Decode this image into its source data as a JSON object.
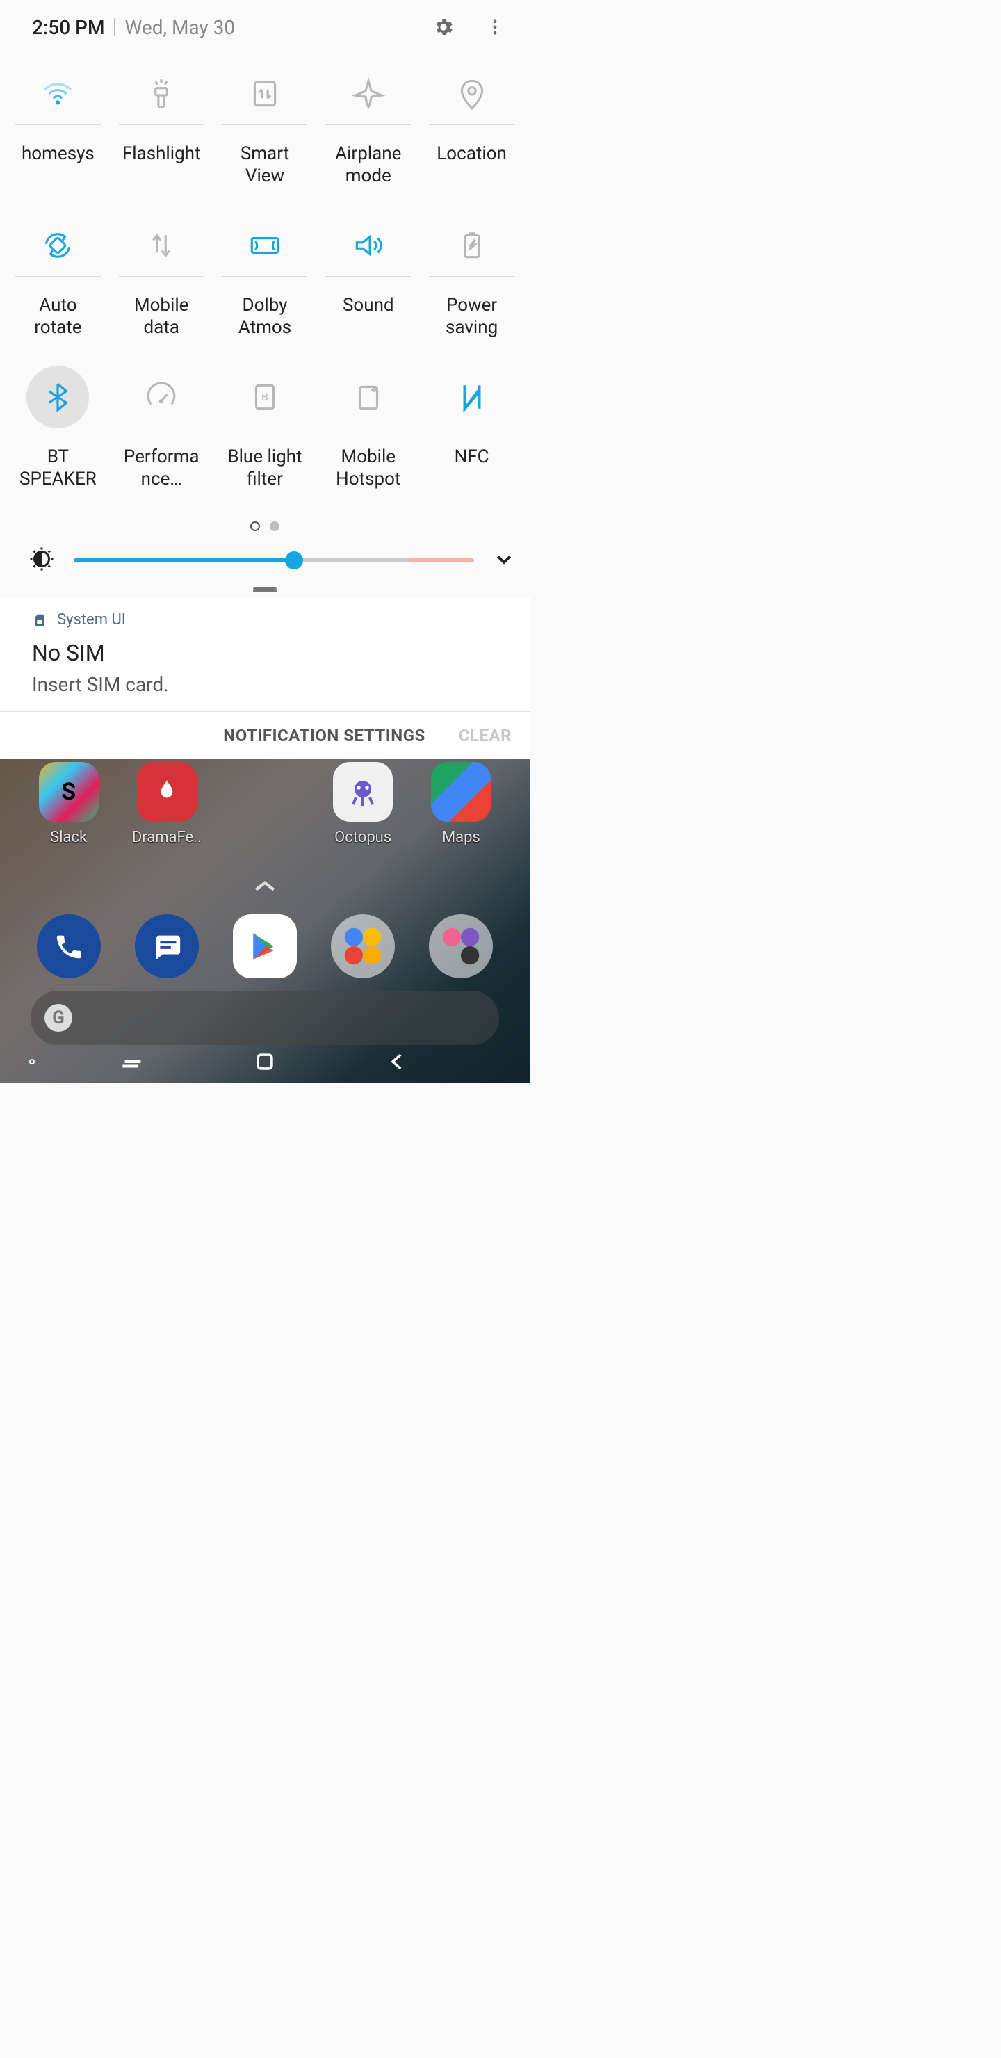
{
  "header": {
    "time": "2:50 PM",
    "date": "Wed, May 30"
  },
  "tiles": [
    {
      "id": "wifi",
      "label": "homesys",
      "active": true
    },
    {
      "id": "flashlight",
      "label": "Flashlight",
      "active": false
    },
    {
      "id": "smartview",
      "label": "Smart View",
      "active": false
    },
    {
      "id": "airplane",
      "label": "Airplane mode",
      "active": false
    },
    {
      "id": "location",
      "label": "Location",
      "active": false
    },
    {
      "id": "autorotate",
      "label": "Auto rotate",
      "active": true
    },
    {
      "id": "mobiledata",
      "label": "Mobile data",
      "active": false
    },
    {
      "id": "dolby",
      "label": "Dolby Atmos",
      "active": true
    },
    {
      "id": "sound",
      "label": "Sound",
      "active": true
    },
    {
      "id": "powersave",
      "label": "Power saving",
      "active": false
    },
    {
      "id": "bluetooth",
      "label": "BT SPEAKER",
      "active": true
    },
    {
      "id": "perf",
      "label": "Performance…",
      "active": false
    },
    {
      "id": "bluelight",
      "label": "Blue light filter",
      "active": false
    },
    {
      "id": "hotspot",
      "label": "Mobile Hotspot",
      "active": false
    },
    {
      "id": "nfc",
      "label": "NFC",
      "active": true
    }
  ],
  "brightness": {
    "percent": 55
  },
  "notification": {
    "app": "System UI",
    "title": "No SIM",
    "body": "Insert SIM card."
  },
  "footer": {
    "settings": "NOTIFICATION SETTINGS",
    "clear": "CLEAR"
  },
  "home_apps_top": [
    {
      "label": "Slack"
    },
    {
      "label": "DramaFe.."
    },
    {
      "label": ""
    },
    {
      "label": "Octopus"
    },
    {
      "label": "Maps"
    }
  ],
  "icons": {
    "wifi": "<svg viewBox='0 0 48 48' stroke-width='3'><path d='M6 18c10-10 26-10 36 0' opacity='.35'/><path d='M12 24c7-7 17-7 24 0' opacity='.55'/><path d='M18 30c4-4 8-4 12 0' opacity='.8'/><circle cx='24' cy='36' r='3' class='fillblue'/></svg>",
    "flashlight": "<svg viewBox='0 0 48 48' stroke-width='3'><path d='M24 4v5M16 7l3 4M32 7l-3 4'/><rect x='16' y='16' width='16' height='10' rx='2'/><path d='M20 26v14a2 2 0 0 0 2 2h4a2 2 0 0 0 2-2V26'/></svg>",
    "smartview": "<svg viewBox='0 0 48 48' stroke-width='3'><rect x='10' y='8' width='28' height='32' rx='3'/><path d='M20 18v12M28 30V18'/><path d='M16 22l4-4M32 26l-4 4'/></svg>",
    "airplane": "<svg viewBox='0 0 48 48' stroke-width='3'><path d='M24 6l4 14 14 6-14 2-2 10-2 4-2-4-2-10-14-2 14-6z'/></svg>",
    "location": "<svg viewBox='0 0 48 48' stroke-width='3'><path d='M24 44s14-14 14-24a14 14 0 1 0-28 0c0 10 14 24 14 24z'/><circle cx='24' cy='20' r='5'/></svg>",
    "autorotate": "<svg viewBox='0 0 48 48' stroke-width='3'><rect x='16' y='16' width='16' height='16' rx='3' transform='rotate(45 24 24)'/><path d='M8 22a16 16 0 0 1 26-10l-3 5'/><path d='M40 26a16 16 0 0 1-26 10l3-5'/></svg>",
    "mobiledata": "<svg viewBox='0 0 48 48' stroke-width='3'><path d='M18 32V14'/><path d='M12 20l6-6 6 6' opacity='0'/><path d='M18 14l-5 6M18 14l5 6' opacity='0'/><path d='M18 32l-5-6M18 32' opacity='0'/><path d='M18 10v24M30 10v24'/><path d='M13 17l5-7 5 7' transform='translate(0 0)'/><path d='M25 31l5 7 5-7'/></svg>",
    "dolby": "<svg viewBox='0 0 48 48' stroke-width='3'><rect x='6' y='14' width='36' height='20' rx='2'/><path d='M11 18a6 8 0 0 1 0 12' /><path d='M37 18a6 8 0 0 0 0 12'/></svg>",
    "sound": "<svg viewBox='0 0 48 48' stroke-width='3'><path d='M8 20v8h8l10 8V12l-10 8z' class='fillblue' fill-opacity='0' /><path d='M8 20v8h8l10 8V12l-10 8z'/><path d='M32 18c3 3 3 9 0 12M37 14c6 6 6 14 0 20'/></svg>",
    "powersave": "<svg viewBox='0 0 48 48' stroke-width='3'><rect x='14' y='10' width='20' height='30' rx='3'/><rect x='20' y='6' width='8' height='4' class='fillgray'/><path d='M20 30l4-6h-2l6-8-3 7h3z'/></svg>",
    "bluetooth": "<svg viewBox='0 0 48 48' stroke-width='3'><path d='M24 6v36l12-10-24-16m0 16l24-16-12-10'/></svg>",
    "perf": "<svg viewBox='0 0 48 48' stroke-width='3'><path d='M10 34a18 18 0 1 1 28 0'/><circle cx='24' cy='30' r='3' class='fillgray'/><path d='M24 30l8-10'/></svg>",
    "bluelight": "<svg viewBox='0 0 48 48' stroke-width='3'><rect x='12' y='8' width='24' height='32' rx='3'/><text x='24' y='29' text-anchor='middle' font-size='14' font-family='sans-serif' class='fillgray' stroke='none'>B</text></svg>",
    "hotspot": "<svg viewBox='0 0 48 48' stroke-width='3'><rect x='12' y='10' width='24' height='30' rx='3'/><path d='M28 14c3 0 4 3 4 3M28 10c6 0 8 7 8 7'/></svg>",
    "nfc": "<svg viewBox='0 0 48 48' stroke-width='4'><path d='M14 8v32l20-24v24'/><path d='M14 8l20 0M14 40l20 0' opacity='0'/><path d='M14 8v32M34 8v32M14 8l20 24M34 8' opacity='0'/><path d='M14 8v32M34 8v32M14 40L34 8' opacity='0'/><path d='M14 8v32M34 8v32'/><path d='M14 8l20 32' opacity='0'/><path d='M14 40l20-32' opacity='0'/><path d='M14 8l0 32 20-26 0 26'/></svg>"
  }
}
